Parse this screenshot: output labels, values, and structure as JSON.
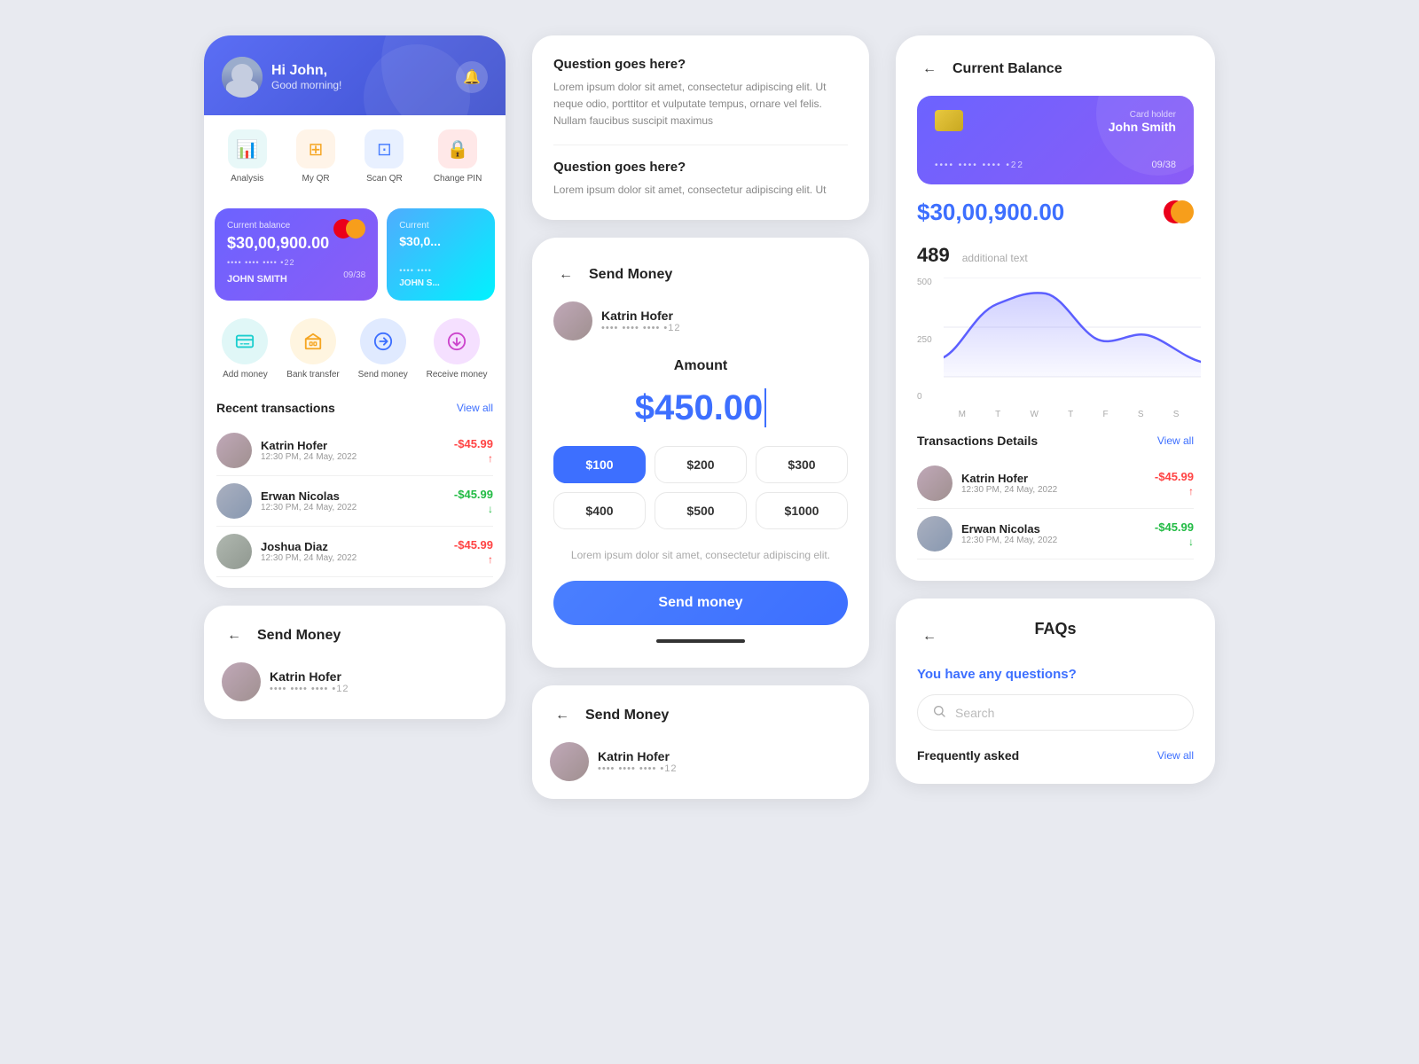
{
  "user": {
    "greeting": "Hi John,",
    "subgreeting": "Good morning!",
    "name": "JOHN SMITH",
    "card_number_masked": "•••• •••• •••• •22",
    "card_expiry": "09/38"
  },
  "quick_actions": [
    {
      "id": "analysis",
      "label": "Analysis",
      "icon": "📊",
      "color": "teal"
    },
    {
      "id": "my_qr",
      "label": "My QR",
      "icon": "⊞",
      "color": "orange"
    },
    {
      "id": "scan_qr",
      "label": "Scan QR",
      "icon": "⊡",
      "color": "blue"
    },
    {
      "id": "change_pin",
      "label": "Change PIN",
      "icon": "🔒",
      "color": "red"
    }
  ],
  "balance": {
    "label": "Current balance",
    "amount": "$30,00,900.00",
    "card_number": "•••• •••• •••• •22",
    "name": "JOHN SMITH",
    "expiry": "09/38",
    "current_label2": "Current",
    "amount2": "$30,0..."
  },
  "services": [
    {
      "id": "add_money",
      "label": "Add money",
      "icon": "💳",
      "color": "cyan"
    },
    {
      "id": "bank_transfer",
      "label": "Bank transfer",
      "icon": "🏦",
      "color": "gold"
    },
    {
      "id": "send_money",
      "label": "Send money",
      "icon": "↗",
      "color": "blue2"
    },
    {
      "id": "receive_money",
      "label": "Receive money",
      "icon": "↙",
      "color": "pink"
    }
  ],
  "recent_transactions": {
    "title": "Recent transactions",
    "view_all": "View all",
    "items": [
      {
        "name": "Katrin Hofer",
        "date": "12:30 PM, 24 May, 2022",
        "amount": "-$45.99",
        "type": "debit"
      },
      {
        "name": "Erwan Nicolas",
        "date": "12:30 PM, 24 May, 2022",
        "amount": "-$45.99",
        "type": "credit"
      },
      {
        "name": "Joshua Diaz",
        "date": "12:30 PM, 24 May, 2022",
        "amount": "-$45.99",
        "type": "debit"
      }
    ]
  },
  "send_money_small": {
    "title": "Send Money",
    "back_label": "←",
    "recipient_name": "Katrin Hofer",
    "recipient_card": "•••• •••• •••• •12"
  },
  "faq": {
    "question1": "Question goes here?",
    "answer1": "Lorem ipsum dolor sit amet, consectetur adipiscing elit. Ut neque odio, porttitor et vulputate tempus, ornare vel felis. Nullam faucibus suscipit maximus",
    "question2": "Question goes here?",
    "answer2": "Lorem ipsum dolor sit amet, consectetur adipiscing elit. Ut"
  },
  "send_money_large": {
    "title": "Send Money",
    "back_label": "←",
    "recipient_name": "Katrin Hofer",
    "recipient_card": "•••• •••• •••• •12",
    "amount_label": "Amount",
    "amount_value": "$450.00",
    "presets": [
      "$100",
      "$200",
      "$300",
      "$400",
      "$500",
      "$1000"
    ],
    "active_preset": "$100",
    "note": "Lorem ipsum dolor sit amet, consectetur adipiscing elit.",
    "send_btn": "Send money"
  },
  "current_balance_card": {
    "title": "Current Balance",
    "back_label": "←",
    "card_holder_label": "Card holder",
    "card_holder_name": "John Smith",
    "card_number": "•••• •••• •••• •22",
    "card_expiry": "09/38",
    "amount": "$30,00,900.00",
    "chart_value": "489",
    "chart_additional": "additional text",
    "chart_y_labels": [
      "500",
      "250",
      "0"
    ],
    "chart_x_labels": [
      "M",
      "T",
      "W",
      "T",
      "F",
      "S",
      "S"
    ],
    "transactions_title": "Transactions Details",
    "view_all": "View all",
    "txn_items": [
      {
        "name": "Katrin Hofer",
        "date": "12:30 PM, 24 May, 2022",
        "amount": "-$45.99",
        "type": "debit"
      },
      {
        "name": "Erwan Nicolas",
        "date": "12:30 PM, 24 May, 2022",
        "amount": "-$45.99",
        "type": "credit"
      }
    ]
  },
  "faqs_bottom": {
    "back_label": "←",
    "title": "FAQs",
    "subtitle": "You have any questions?",
    "search_placeholder": "Search",
    "freq_title": "Frequently asked",
    "view_all": "View all"
  }
}
